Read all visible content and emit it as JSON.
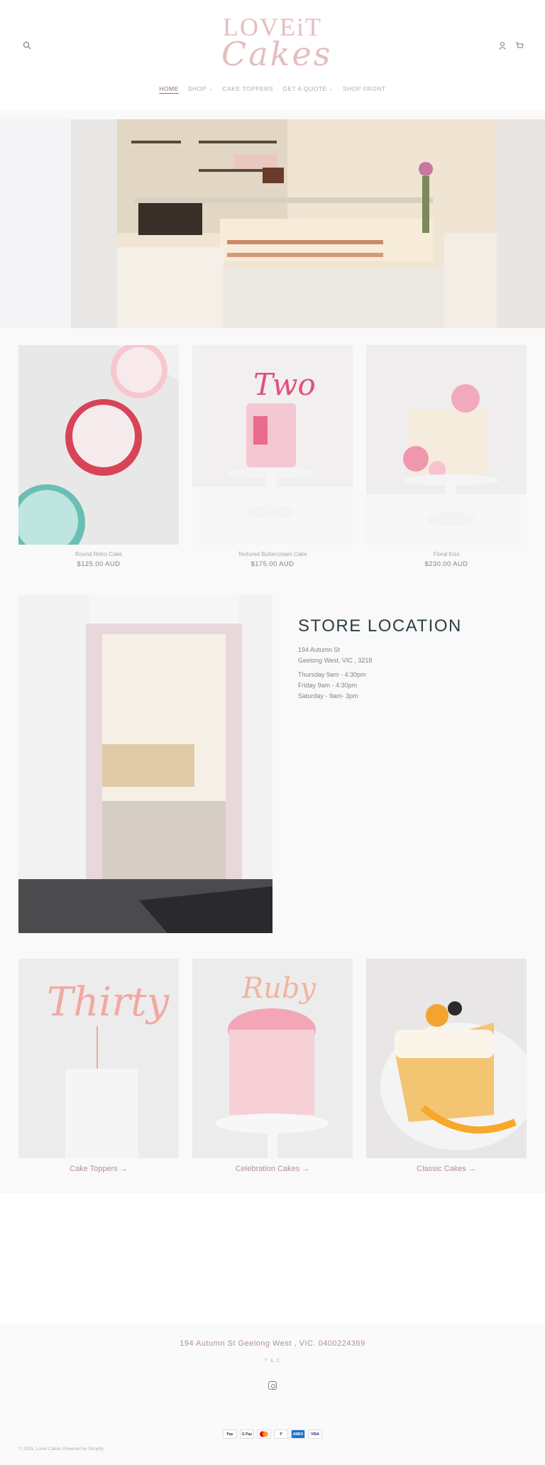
{
  "header": {
    "logo_top": "LOVEiT",
    "logo_bottom": "Cakes",
    "nav": [
      {
        "label": "HOME",
        "active": true,
        "dropdown": false
      },
      {
        "label": "SHOP",
        "active": false,
        "dropdown": true
      },
      {
        "label": "CAKE TOPPERS",
        "active": false,
        "dropdown": false
      },
      {
        "label": "GET A QUOTE",
        "active": false,
        "dropdown": true
      },
      {
        "label": "SHOP FRONT",
        "active": false,
        "dropdown": false
      }
    ],
    "icons": {
      "search": "search-icon",
      "account": "account-icon",
      "cart": "cart-icon"
    }
  },
  "products": [
    {
      "title": "Round Retro Cake",
      "price": "$125.00 AUD"
    },
    {
      "title": "Textured Buttercream Cake",
      "price": "$175.00 AUD"
    },
    {
      "title": "Floral Kiss",
      "price": "$230.00 AUD"
    }
  ],
  "store": {
    "title": "STORE LOCATION",
    "address1": "194 Autumn St",
    "address2": "Geelong West, VIC , 3218",
    "hours1": "Thursday 9am - 4:30pm",
    "hours2": "Friday 9am - 4:30pm",
    "hours3": "Saturday - 9am- 3pm"
  },
  "collections": [
    {
      "label": "Cake Toppers →"
    },
    {
      "label": "Celebration Cakes →"
    },
    {
      "label": "Classic Cakes →"
    }
  ],
  "footer": {
    "address": "194 Autumn St Geelong West , VIC. 0400224369",
    "tc": "T & C",
    "payments": [
      "Pay",
      "G Pay",
      "",
      "P",
      "AMEX",
      "VISA"
    ],
    "copyright": "© 2025, Lovel Cakes Powered by Shopify"
  },
  "colors": {
    "brand_pink": "#e6bcc0",
    "accent": "#b38f97",
    "heading": "#2d3d46"
  }
}
